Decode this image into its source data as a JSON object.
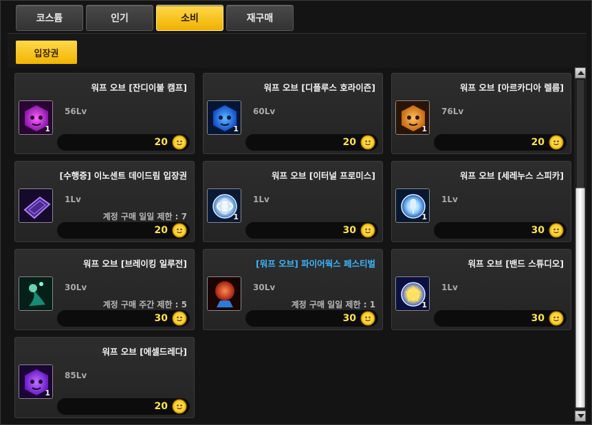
{
  "tabs": [
    {
      "label": "코스튬"
    },
    {
      "label": "인기"
    },
    {
      "label": "소비"
    },
    {
      "label": "재구매"
    }
  ],
  "active_tab": "소비",
  "subtab": {
    "label": "입장권"
  },
  "colors": {
    "accent": "#f5c518",
    "price": "#ffe24a",
    "highlight_name": "#3cb7ff"
  },
  "items": [
    {
      "name": "워프 오브 [잔디이불 캠프]",
      "level": "56Lv",
      "limit": "",
      "price": "20",
      "qty": "1",
      "icon": "purple-orb-icon"
    },
    {
      "name": "워프 오브 [디플루스 호라이즌]",
      "level": "60Lv",
      "limit": "",
      "price": "20",
      "qty": "1",
      "icon": "blue-orb-icon"
    },
    {
      "name": "워프 오브 [아르카디아 렐름]",
      "level": "76Lv",
      "limit": "",
      "price": "20",
      "qty": "1",
      "icon": "orange-orb-icon"
    },
    {
      "name": "[수행증] 이노센트 데이드림 입장권",
      "level": "1Lv",
      "limit": "계정 구매 일일 제한 : 7",
      "price": "20",
      "qty": "",
      "icon": "ticket-icon"
    },
    {
      "name": "워프 오브 [이터널 프로미스]",
      "level": "1Lv",
      "limit": "",
      "price": "30",
      "qty": "1",
      "icon": "rings-orb-icon"
    },
    {
      "name": "워프 오브 [세레누스 스피카]",
      "level": "1Lv",
      "limit": "",
      "price": "30",
      "qty": "1",
      "icon": "microphone-orb-icon"
    },
    {
      "name": "워프 오브 [브레이킹 일루전]",
      "level": "30Lv",
      "limit": "계정 구매 주간 제한 : 5",
      "price": "30",
      "qty": "",
      "icon": "teal-swirl-icon"
    },
    {
      "name": "[워프 오브] 파이어웍스 페스티벌",
      "level": "30Lv",
      "limit": "계정 구매 일일 제한 : 1",
      "price": "30",
      "qty": "",
      "icon": "crystal-ball-icon",
      "highlight": true
    },
    {
      "name": "워프 오브 [밴드 스튜디오]",
      "level": "1Lv",
      "limit": "",
      "price": "30",
      "qty": "1",
      "icon": "star-orb-icon"
    },
    {
      "name": "워프 오브 [에셀드레다]",
      "level": "85Lv",
      "limit": "",
      "price": "20",
      "qty": "1",
      "icon": "violet-orb-icon"
    }
  ]
}
